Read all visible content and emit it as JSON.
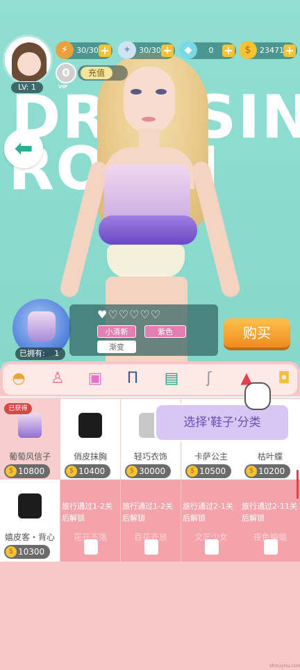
{
  "stage": {
    "big_word_line1": "DRESSING",
    "big_word_line2": "ROOM"
  },
  "header": {
    "level": "LV: 1",
    "energy": "30/30",
    "stamina": "30/30",
    "diamonds": "0",
    "coins": "23471",
    "vip_level": "0",
    "vip_text": "VIP",
    "recharge_label": "充值"
  },
  "item": {
    "owned_label": "已拥有:",
    "owned_count": "1",
    "hearts": "♥♡♡♡♡♡",
    "tags": [
      "小清新",
      "紫色",
      "渐变"
    ],
    "buy_label": "购买"
  },
  "categories": [
    "hat-icon",
    "dress-icon",
    "top-icon",
    "pants-icon",
    "coat-icon",
    "socks-icon",
    "shoe-icon",
    "bag-icon"
  ],
  "tip": "选择'鞋子'分类",
  "grid": {
    "owned_badge": "已获得",
    "row1": [
      {
        "name": "葡萄风信子",
        "price": "10800"
      },
      {
        "name": "俏皮抹胸",
        "price": "10400"
      },
      {
        "name": "轻巧衣饰",
        "price": "30000"
      },
      {
        "name": "卡萨公主",
        "price": "10500"
      },
      {
        "name": "枯叶蝶",
        "price": "10200"
      }
    ],
    "row2_first": {
      "name": "嬉皮客・背心",
      "price": "10300"
    },
    "row2_locked": [
      {
        "msg": "旅行通过1-2关后解锁",
        "faint": "花开不落"
      },
      {
        "msg": "旅行通过1-2关后解锁",
        "faint": "百花齐放"
      },
      {
        "msg": "旅行通过2-1关后解锁",
        "faint": "文艺少女"
      },
      {
        "msg": "旅行通过2-11关后解锁",
        "faint": "夜色蝙蝠"
      }
    ]
  },
  "watermark": "shouyou.com"
}
